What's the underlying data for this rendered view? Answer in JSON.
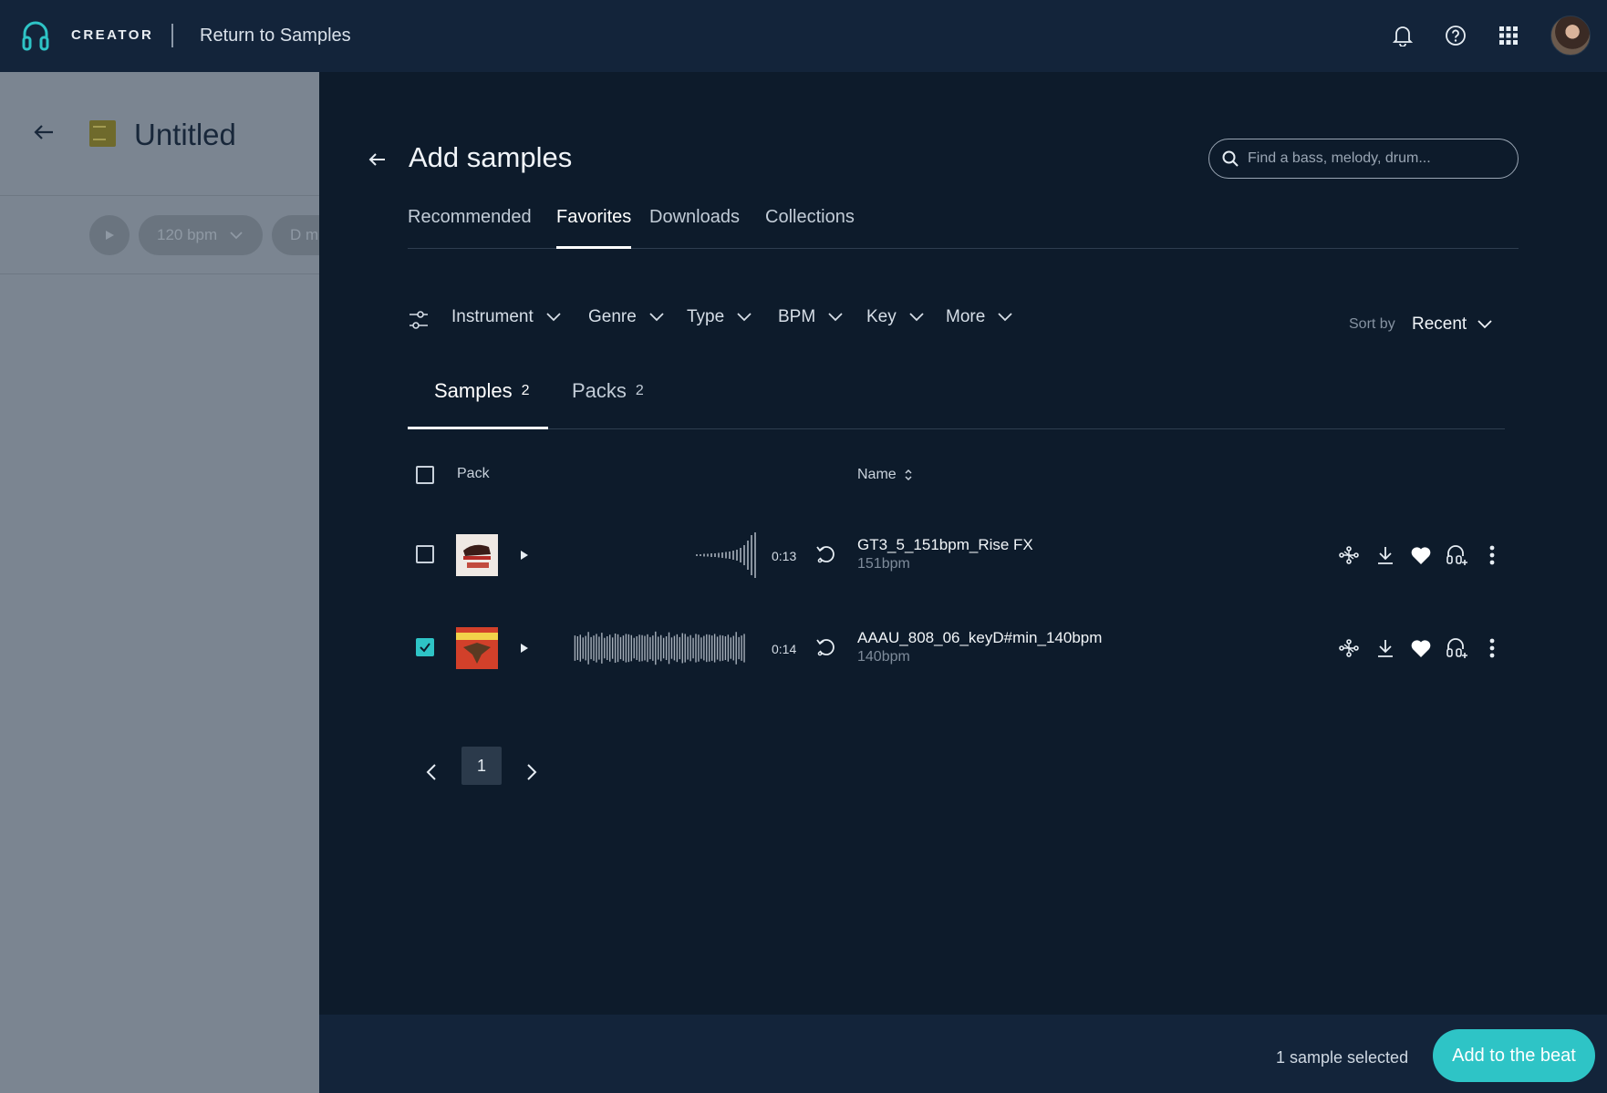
{
  "topbar": {
    "brand": "CREATOR",
    "return_link": "Return to Samples",
    "icons": [
      "logo-headphones-icon",
      "bell-icon",
      "help-icon",
      "apps-grid-icon",
      "avatar"
    ]
  },
  "left_panel": {
    "title": "Untitled",
    "bpm": "120 bpm",
    "key_partial": "D m"
  },
  "main": {
    "title": "Add samples",
    "search_placeholder": "Find a bass, melody, drum...",
    "tabs": [
      {
        "label": "Recommended",
        "active": false
      },
      {
        "label": "Favorites",
        "active": true
      },
      {
        "label": "Downloads",
        "active": false
      },
      {
        "label": "Collections",
        "active": false
      }
    ],
    "filters": [
      "Instrument",
      "Genre",
      "Type",
      "BPM",
      "Key",
      "More"
    ],
    "sort": {
      "label": "Sort by",
      "value": "Recent"
    },
    "subtabs": [
      {
        "label": "Samples",
        "count": "2",
        "active": true
      },
      {
        "label": "Packs",
        "count": "2",
        "active": false
      }
    ],
    "table_headers": {
      "pack": "Pack",
      "name": "Name"
    },
    "samples": [
      {
        "name": "GT3_5_151bpm_Rise FX",
        "bpm": "151bpm",
        "duration": "0:13",
        "checked": false
      },
      {
        "name": "AAAU_808_06_keyD#min_140bpm",
        "bpm": "140bpm",
        "duration": "0:14",
        "checked": true
      }
    ],
    "pagination": {
      "current": "1"
    }
  },
  "footer": {
    "selected_text": "1 sample selected",
    "add_button": "Add to the beat"
  },
  "colors": {
    "accent": "#2ec4c6",
    "background": "#0d1b2b",
    "topbar": "#13243a"
  }
}
